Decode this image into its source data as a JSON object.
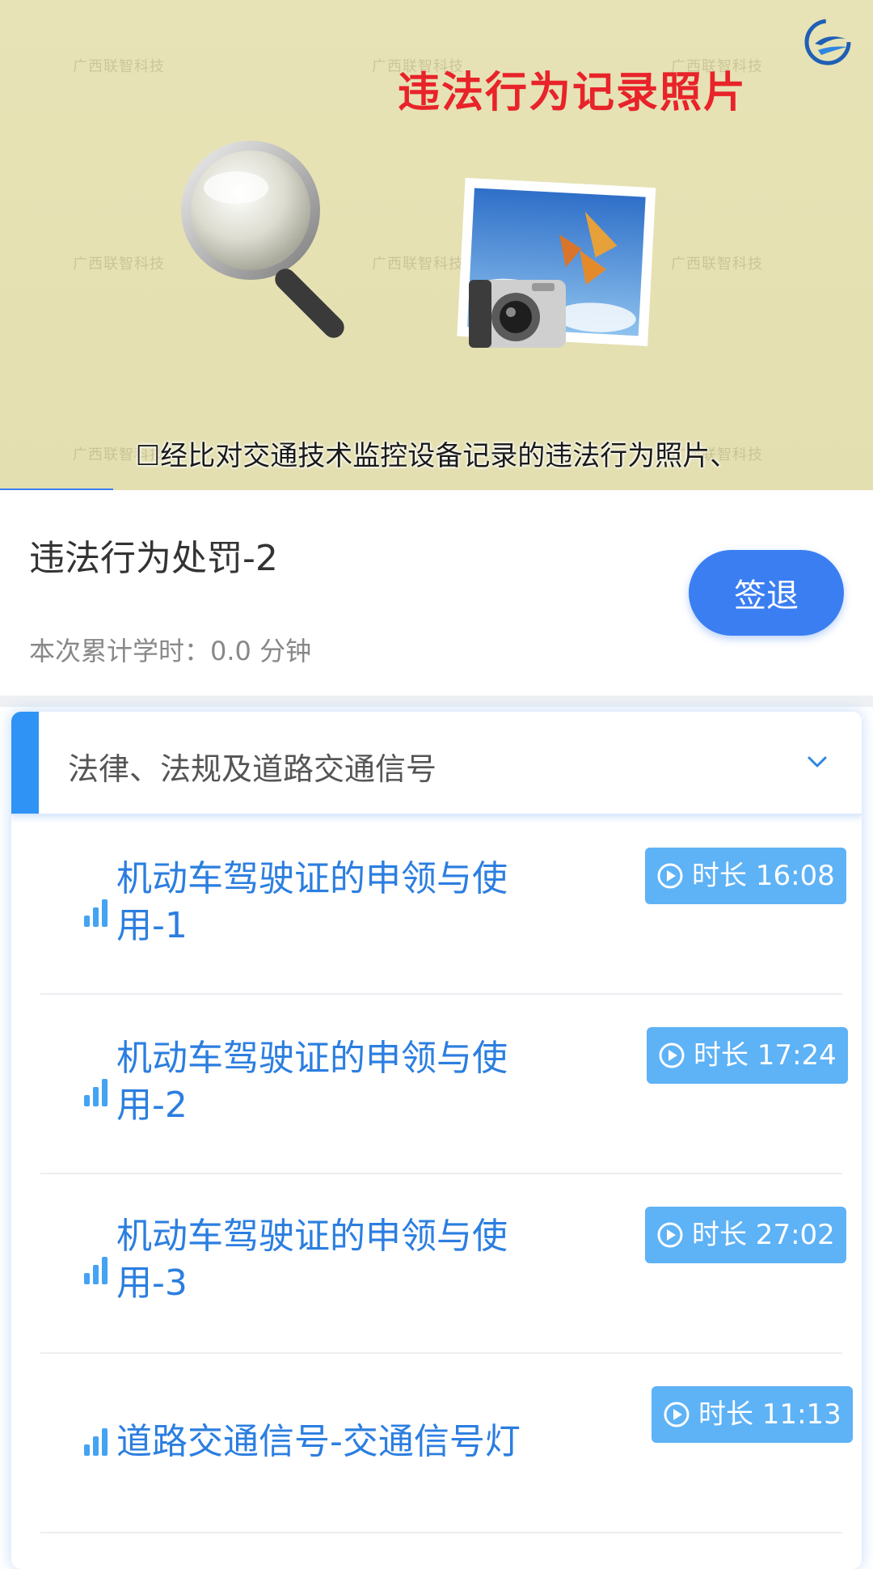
{
  "video": {
    "watermark_text": "广西联智科技",
    "title": "违法行为记录照片",
    "subtitle": "☐经比对交通技术监控设备记录的违法行为照片、",
    "progress": 0.13,
    "logo_icon": "app-logo-icon"
  },
  "info": {
    "course_title": "违法行为处罚-2",
    "study_time": "本次累计学时：0.0 分钟",
    "checkout_label": "签退"
  },
  "chapter": {
    "title": "法律、法规及道路交通信号",
    "expand_icon": "chevron-down-icon",
    "lessons": [
      {
        "name": "机动车驾驶证的申领与使用-1",
        "duration": "时长 16:08"
      },
      {
        "name": "机动车驾驶证的申领与使用-2",
        "duration": "时长 17:24"
      },
      {
        "name": "机动车驾驶证的申领与使用-3",
        "duration": "时长 27:02"
      },
      {
        "name": "道路交通信号-交通信号灯",
        "duration": "时长 11:13"
      }
    ]
  },
  "colors": {
    "accent": "#3a7ef2",
    "lesson_text": "#2b7ee0",
    "duration_badge": "#5eb2f6",
    "video_title": "#e8232a"
  }
}
